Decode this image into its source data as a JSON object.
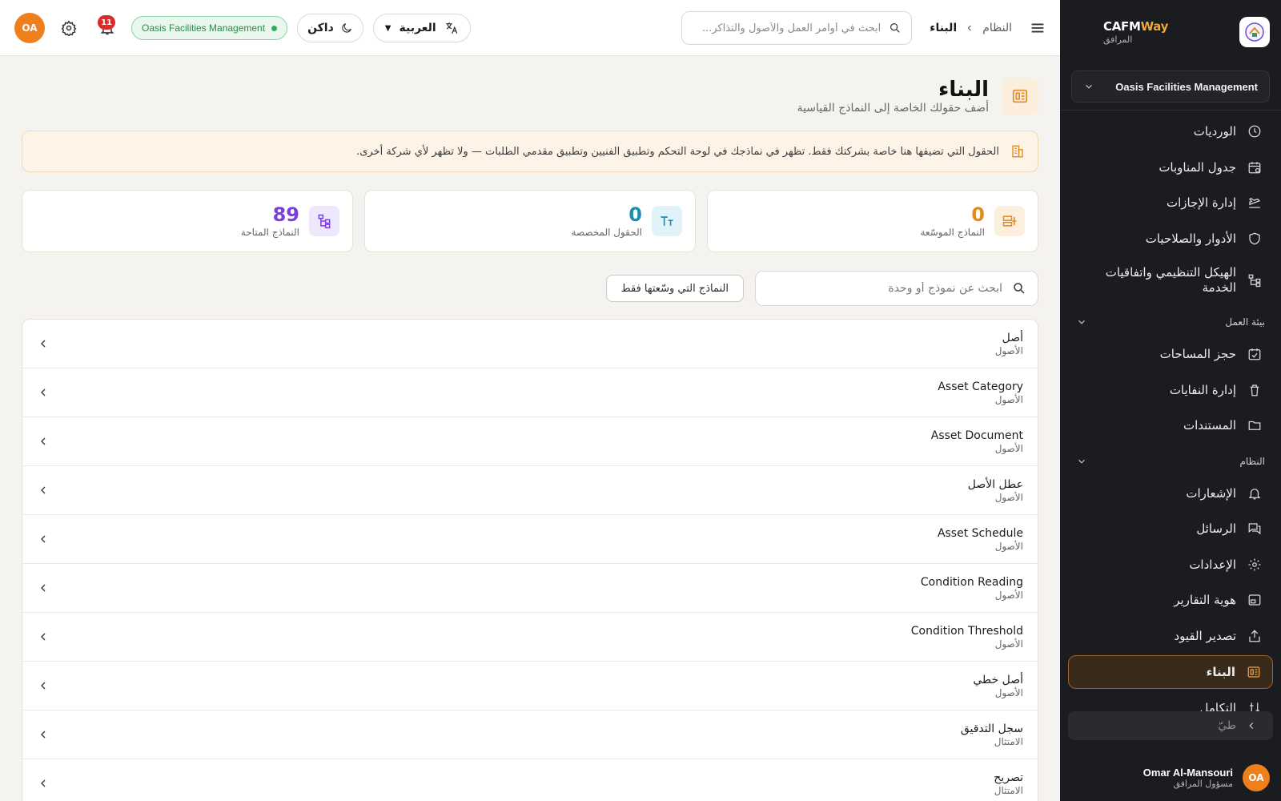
{
  "brand": {
    "name_part1": "CAFM",
    "name_part2": "Way",
    "subtitle": "المرافق"
  },
  "sidebar": {
    "org_selector": "Oasis Facilities Management",
    "items_top": [
      {
        "label": "الورديات",
        "icon": "clock-icon"
      },
      {
        "label": "جدول المناوبات",
        "icon": "calendar-icon"
      },
      {
        "label": "إدارة الإجازات",
        "icon": "plane-icon"
      },
      {
        "label": "الأدوار والصلاحيات",
        "icon": "shield-icon"
      },
      {
        "label": "الهيكل التنظيمي واتفاقيات الخدمة",
        "icon": "org-chart-icon"
      }
    ],
    "section_workplace": "بيئة العمل",
    "items_workplace": [
      {
        "label": "حجز المساحات",
        "icon": "calendar-check-icon"
      },
      {
        "label": "إدارة النفايات",
        "icon": "trash-icon"
      },
      {
        "label": "المستندات",
        "icon": "folder-icon"
      }
    ],
    "section_system": "النظام",
    "items_system": [
      {
        "label": "الإشعارات",
        "icon": "bell-icon"
      },
      {
        "label": "الرسائل",
        "icon": "messages-icon"
      },
      {
        "label": "الإعدادات",
        "icon": "gear-icon"
      },
      {
        "label": "هوية التقارير",
        "icon": "report-icon"
      },
      {
        "label": "تصدير القيود",
        "icon": "export-icon"
      },
      {
        "label": "البناء",
        "icon": "builder-icon",
        "active": true
      },
      {
        "label": "التكامل",
        "icon": "integration-icon"
      }
    ],
    "collapse_label": "طيّ",
    "user": {
      "initials": "OA",
      "name": "Omar Al-Mansouri",
      "role": "مسؤول المرافق"
    }
  },
  "topbar": {
    "breadcrumb": {
      "parent": "النظام",
      "current": "البناء"
    },
    "search_placeholder": "ابحث في أوامر العمل والأصول والتذاكر...",
    "language": "العربية",
    "theme": "داكن",
    "org_badge": "Oasis Facilities Management",
    "notifications_count": "11",
    "user_initials": "OA"
  },
  "page": {
    "title": "البناء",
    "subtitle": "أضف حقولك الخاصة إلى النماذج القياسية",
    "notice": "الحقول التي تضيفها هنا خاصة بشركتك فقط. تظهر في نماذجك في لوحة التحكم وتطبيق الفنيين وتطبيق مقدمي الطلبات — ولا تظهر لأي شركة أخرى."
  },
  "stats": [
    {
      "value": "0",
      "label": "النماذج الموسّعة",
      "color": "#e58a1c",
      "bg": "#fcefdd",
      "icon": "extended-forms-icon"
    },
    {
      "value": "0",
      "label": "الحقول المخصصة",
      "color": "#1a8fb0",
      "bg": "#e1f3f8",
      "icon": "text-size-icon"
    },
    {
      "value": "89",
      "label": "النماذج المتاحة",
      "color": "#7b3fe0",
      "bg": "#efe7fb",
      "icon": "tree-icon"
    }
  ],
  "toolbar": {
    "search_placeholder": "ابحث عن نموذج أو وحدة",
    "filter_label": "النماذج التي وسّعتها فقط"
  },
  "forms": [
    {
      "title": "أصل",
      "module": "الأصول"
    },
    {
      "title": "Asset Category",
      "module": "الأصول"
    },
    {
      "title": "Asset Document",
      "module": "الأصول"
    },
    {
      "title": "عطل الأصل",
      "module": "الأصول"
    },
    {
      "title": "Asset Schedule",
      "module": "الأصول"
    },
    {
      "title": "Condition Reading",
      "module": "الأصول"
    },
    {
      "title": "Condition Threshold",
      "module": "الأصول"
    },
    {
      "title": "أصل خطي",
      "module": "الأصول"
    },
    {
      "title": "سجل التدقيق",
      "module": "الامتثال"
    },
    {
      "title": "تصريح",
      "module": "الامتثال"
    }
  ]
}
